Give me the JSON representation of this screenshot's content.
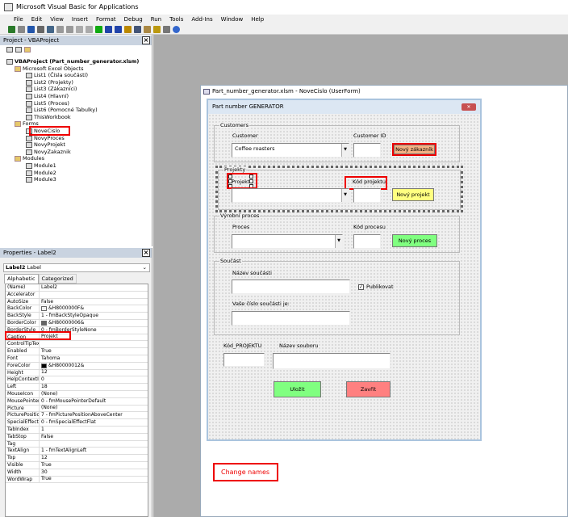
{
  "app": {
    "title": "Microsoft Visual Basic for Applications"
  },
  "menu": [
    "File",
    "Edit",
    "View",
    "Insert",
    "Format",
    "Debug",
    "Run",
    "Tools",
    "Add-Ins",
    "Window",
    "Help"
  ],
  "toolbar_icons": [
    "excel-icon",
    "insert-userform-icon",
    "save-icon",
    "cut-icon",
    "copy-icon",
    "paste-icon",
    "find-icon",
    "undo-icon",
    "redo-icon",
    "run-icon",
    "break-icon",
    "reset-icon",
    "design-mode-icon",
    "project-explorer-icon",
    "properties-icon",
    "object-browser-icon",
    "toolbox-icon",
    "help-icon"
  ],
  "project": {
    "title": "Project - VBAProject",
    "root": "VBAProject (Part_number_generator.xlsm)",
    "excel_folder": "Microsoft Excel Objects",
    "sheets": [
      "List1 (Čísla součástí)",
      "List2 (Projekty)",
      "List3 (Zákazníci)",
      "List4 (Hlavní)",
      "List5 (Proces)",
      "List6 (Pomocné Tabulky)",
      "ThisWorkbook"
    ],
    "forms_folder": "Forms",
    "forms": [
      "NoveCislo",
      "NovyProces",
      "NovyProjekt",
      "NovyZakaznik"
    ],
    "modules_folder": "Modules",
    "modules": [
      "Module1",
      "Module2",
      "Module3"
    ]
  },
  "properties": {
    "title": "Properties - Label2",
    "object_name": "Label2",
    "object_type": "Label",
    "tabs": [
      "Alphabetic",
      "Categorized"
    ],
    "rows": [
      {
        "k": "(Name)",
        "v": "Label2"
      },
      {
        "k": "Accelerator",
        "v": ""
      },
      {
        "k": "AutoSize",
        "v": "False"
      },
      {
        "k": "BackColor",
        "v": "&H8000000F&",
        "color": "#f0f0f0"
      },
      {
        "k": "BackStyle",
        "v": "1 - fmBackStyleOpaque"
      },
      {
        "k": "BorderColor",
        "v": "&H80000006&",
        "color": "#646464"
      },
      {
        "k": "BorderStyle",
        "v": "0 - fmBorderStyleNone"
      },
      {
        "k": "Caption",
        "v": "Projekt"
      },
      {
        "k": "ControlTipText",
        "v": ""
      },
      {
        "k": "Enabled",
        "v": "True"
      },
      {
        "k": "Font",
        "v": "Tahoma"
      },
      {
        "k": "ForeColor",
        "v": "&H80000012&",
        "color": "#000000"
      },
      {
        "k": "Height",
        "v": "12"
      },
      {
        "k": "HelpContextID",
        "v": "0"
      },
      {
        "k": "Left",
        "v": "18"
      },
      {
        "k": "MouseIcon",
        "v": "(None)"
      },
      {
        "k": "MousePointer",
        "v": "0 - fmMousePointerDefault"
      },
      {
        "k": "Picture",
        "v": "(None)"
      },
      {
        "k": "PicturePosition",
        "v": "7 - fmPicturePositionAboveCenter"
      },
      {
        "k": "SpecialEffect",
        "v": "0 - fmSpecialEffectFlat"
      },
      {
        "k": "TabIndex",
        "v": "1"
      },
      {
        "k": "TabStop",
        "v": "False"
      },
      {
        "k": "Tag",
        "v": ""
      },
      {
        "k": "TextAlign",
        "v": "1 - fmTextAlignLeft"
      },
      {
        "k": "Top",
        "v": "12"
      },
      {
        "k": "Visible",
        "v": "True"
      },
      {
        "k": "Width",
        "v": "30"
      },
      {
        "k": "WordWrap",
        "v": "True"
      }
    ]
  },
  "codewin": {
    "title": "Part_number_generator.xlsm - NoveCislo (UserForm)"
  },
  "form": {
    "title": "Part number GENERATOR",
    "customers": {
      "caption": "Customers",
      "customer_label": "Customer",
      "customer_value": "Coffee roasters",
      "id_label": "Customer ID",
      "new_button": "Nový zákazník"
    },
    "projekty": {
      "caption": "Projekty",
      "label": "Projekt",
      "code_label": "Kód projektu",
      "new_button": "Nový projekt"
    },
    "proces": {
      "caption": "Výrobní proces",
      "label": "Proces",
      "code_label": "Kód procesu",
      "new_button": "Nový proces"
    },
    "soucast": {
      "caption": "Součást",
      "name_label": "Název součásti",
      "publish_label": "Publikovat",
      "publish_checked": true,
      "number_label": "Vaše číslo součásti je:"
    },
    "kod_label": "Kód_PROJEKTU",
    "file_label": "Název souboru",
    "save_button": "Uložit",
    "close_button": "Zavřít"
  },
  "annotation": "Change names",
  "colors": {
    "orange": "#f4b183",
    "yellow": "#ffff80",
    "green": "#80ff80",
    "red": "#ff8080",
    "annotation": "#e00000"
  }
}
